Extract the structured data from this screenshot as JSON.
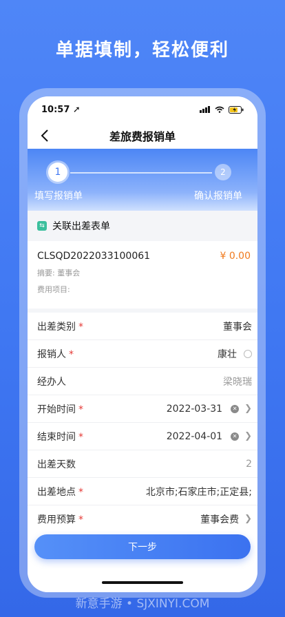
{
  "headline": "单据填制，轻松便利",
  "status": {
    "time": "10:57"
  },
  "nav": {
    "title": "差旅费报销单"
  },
  "steps": [
    {
      "num": "1",
      "label": "填写报销单"
    },
    {
      "num": "2",
      "label": "确认报销单"
    }
  ],
  "section": {
    "title": "关联出差表单"
  },
  "doc": {
    "number": "CLSQD2022033100061",
    "amount": "¥ 0.00",
    "summary": "摘要: 董事会",
    "expense_item": "费用项目:"
  },
  "fields": {
    "trip_type": {
      "label": "出差类别",
      "value": "董事会"
    },
    "claimant": {
      "label": "报销人",
      "value": "康壮"
    },
    "handler": {
      "label": "经办人",
      "value": "梁晓瑞"
    },
    "start_time": {
      "label": "开始时间",
      "value": "2022-03-31"
    },
    "end_time": {
      "label": "结束时间",
      "value": "2022-04-01"
    },
    "days": {
      "label": "出差天数",
      "value": "2"
    },
    "location": {
      "label": "出差地点",
      "value": "北京市;石家庄市;正定县;"
    },
    "budget": {
      "label": "费用预算",
      "value": "董事会费"
    }
  },
  "next_button": "下一步",
  "watermark": "新意手游 • SJXINYI.COM",
  "colors": {
    "primary": "#3f77f2",
    "amount": "#f07a1e",
    "required": "#e53935",
    "link_icon": "#3bbf9d"
  }
}
